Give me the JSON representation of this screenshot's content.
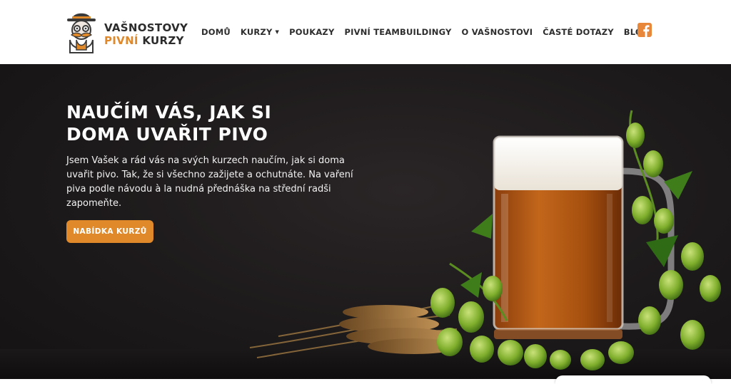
{
  "brand": {
    "line1": "VAŠNOSTOVY",
    "line2_accent": "PIVNÍ",
    "line2_rest": " KURZY",
    "mascot_icon": "mustached-man-with-hat-logo",
    "accent_color": "#e0892a"
  },
  "nav": {
    "items": [
      {
        "label": "DOMŮ"
      },
      {
        "label": "KURZY",
        "dropdown_icon": "caret-down-icon"
      },
      {
        "label": "POUKAZY"
      },
      {
        "label": "PIVNÍ TEAMBUILDINGY"
      },
      {
        "label": "O VAŠNOSTOVI"
      },
      {
        "label": "ČASTÉ DOTAZY"
      },
      {
        "label": "BLOG"
      }
    ],
    "social_icon": "facebook-icon",
    "social_color": "#e8873a"
  },
  "hero": {
    "title_line1": "NAUČÍM VÁS, JAK SI",
    "title_line2": "DOMA UVAŘIT PIVO",
    "text": "Jsem Vašek a rád vás na svých kurzech naučím, jak si doma uvařit pivo. Tak, že si všechno zažijete a ochutnáte. Na vaření piva podle návodu à la nudná přednáška na střední radši zapomeňte.",
    "cta_label": "NABÍDKA KURZŮ",
    "image": "beer-mug-with-hops-and-wheat"
  }
}
